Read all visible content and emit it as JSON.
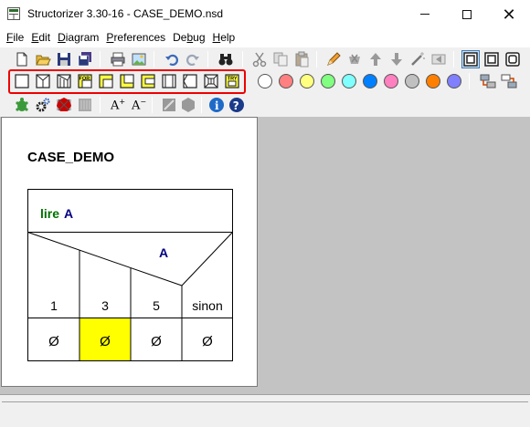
{
  "window": {
    "title": "Structorizer 3.30-16 - CASE_DEMO.nsd",
    "minimize_glyph": "",
    "close_glyph": "✕"
  },
  "menu": [
    {
      "first": "F",
      "rest": "ile"
    },
    {
      "first": "E",
      "rest": "dit"
    },
    {
      "first": "D",
      "rest": "iagram"
    },
    {
      "first": "P",
      "rest": "references"
    },
    {
      "first": "",
      "rest": "De",
      "second_u": "b",
      "tail": "ug"
    },
    {
      "first": "H",
      "rest": "elp"
    }
  ],
  "toolbar": {
    "highlight_color": "#e00000",
    "color_palette": [
      "#ffffff",
      "#ff8080",
      "#ffff80",
      "#80ff80",
      "#80ffff",
      "#0080ff",
      "#ff80c0",
      "#c0c0c0",
      "#ff8000",
      "#8080ff"
    ],
    "element_icons": [
      "instruction-icon",
      "if-icon",
      "case-icon",
      "for-icon",
      "while-icon",
      "repeat-icon",
      "forever-icon",
      "call-icon",
      "jump-icon",
      "parallel-icon",
      "try-icon"
    ],
    "font_up_label": "A",
    "font_down_label": "A",
    "for_label": "FOR",
    "try_label": "TRY",
    "info_label": "i",
    "help_label": "?"
  },
  "diagram": {
    "name": "CASE_DEMO",
    "instruction_keyword": "lire",
    "instruction_var": "A",
    "case_selector": "A",
    "branches": [
      "1",
      "3",
      "5",
      "sinon"
    ],
    "branch_contents": [
      "Ø",
      "Ø",
      "Ø",
      "Ø"
    ],
    "selected_branch_index": 1,
    "colors": {
      "keyword": "#007000",
      "variable": "#000080",
      "selected_fill": "#ffff00"
    }
  }
}
